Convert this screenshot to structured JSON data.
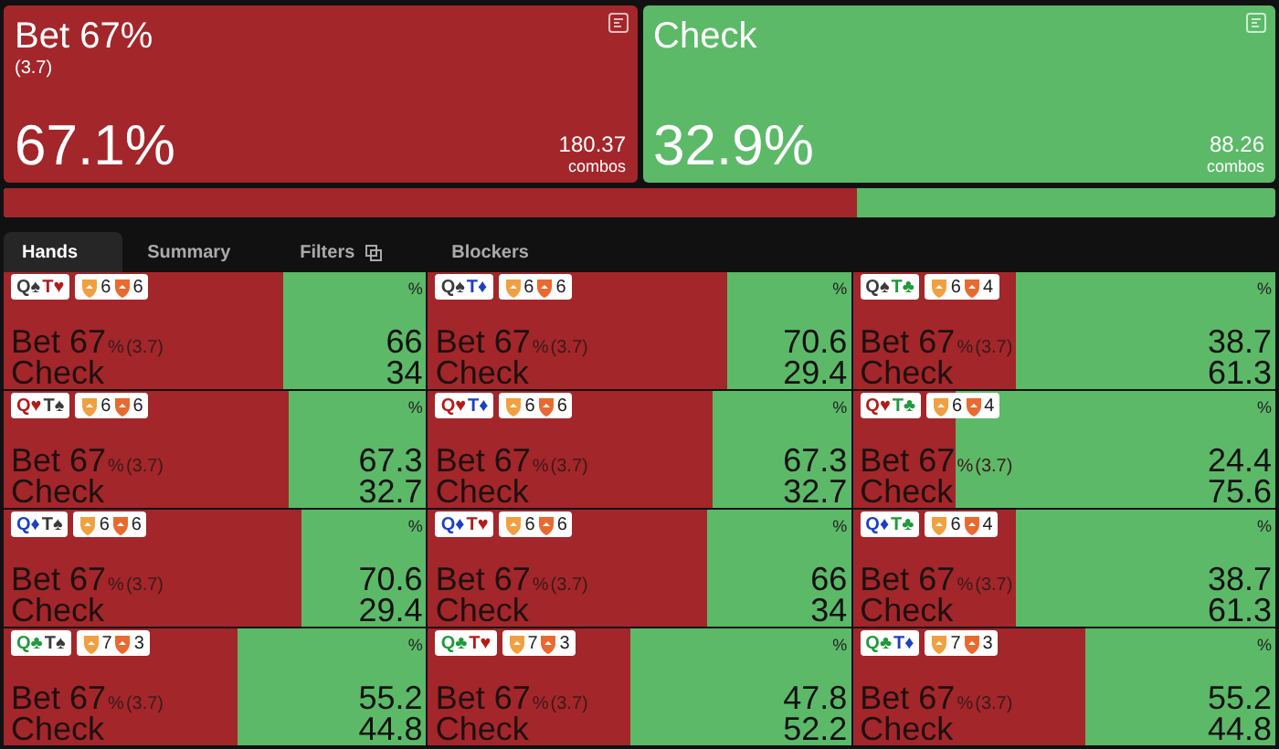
{
  "actions": [
    {
      "title": "Bet 67%",
      "size": "(3.7)",
      "percent": "67.1%",
      "combos": "180.37",
      "combos_label": "combos",
      "color": "#a3262a"
    },
    {
      "title": "Check",
      "percent": "32.9%",
      "combos": "88.26",
      "combos_label": "combos",
      "color": "#5cb968"
    }
  ],
  "summary_bar": {
    "level": 0.671
  },
  "tabs": [
    {
      "label": "Hands",
      "selected": true
    },
    {
      "label": "Summary",
      "selected": false
    },
    {
      "label": "Filters",
      "selected": false,
      "icon": true
    },
    {
      "label": "Blockers",
      "selected": false
    }
  ],
  "hand_grid": {
    "percent_header": "%",
    "rows": [
      [
        {
          "cards": [
            {
              "rank": "Q",
              "suit": "♠",
              "color": "#3a3a3a"
            },
            {
              "rank": "T",
              "suit": "♥",
              "color": "#b31b1b"
            }
          ],
          "blockers": [
            "6",
            "6"
          ],
          "bet_label": "Bet 67",
          "bet_unit": "%",
          "bet_size": "(3.7)",
          "check_label": "Check",
          "bet_value": "66",
          "check_value": "34",
          "level": 0.66
        },
        {
          "cards": [
            {
              "rank": "Q",
              "suit": "♠",
              "color": "#3a3a3a"
            },
            {
              "rank": "T",
              "suit": "♦",
              "color": "#1d3fc4"
            }
          ],
          "blockers": [
            "6",
            "6"
          ],
          "bet_label": "Bet 67",
          "bet_unit": "%",
          "bet_size": "(3.7)",
          "check_label": "Check",
          "bet_value": "70.6",
          "check_value": "29.4",
          "level": 0.706
        },
        {
          "cards": [
            {
              "rank": "Q",
              "suit": "♠",
              "color": "#3a3a3a"
            },
            {
              "rank": "T",
              "suit": "♣",
              "color": "#1e9a3a"
            }
          ],
          "blockers": [
            "6",
            "4"
          ],
          "bet_label": "Bet 67",
          "bet_unit": "%",
          "bet_size": "(3.7)",
          "check_label": "Check",
          "bet_value": "38.7",
          "check_value": "61.3",
          "level": 0.387
        }
      ],
      [
        {
          "cards": [
            {
              "rank": "Q",
              "suit": "♥",
              "color": "#b31b1b"
            },
            {
              "rank": "T",
              "suit": "♠",
              "color": "#3a3a3a"
            }
          ],
          "blockers": [
            "6",
            "6"
          ],
          "bet_label": "Bet 67",
          "bet_unit": "%",
          "bet_size": "(3.7)",
          "check_label": "Check",
          "bet_value": "67.3",
          "check_value": "32.7",
          "level": 0.673
        },
        {
          "cards": [
            {
              "rank": "Q",
              "suit": "♥",
              "color": "#b31b1b"
            },
            {
              "rank": "T",
              "suit": "♦",
              "color": "#1d3fc4"
            }
          ],
          "blockers": [
            "6",
            "6"
          ],
          "bet_label": "Bet 67",
          "bet_unit": "%",
          "bet_size": "(3.7)",
          "check_label": "Check",
          "bet_value": "67.3",
          "check_value": "32.7",
          "level": 0.673
        },
        {
          "cards": [
            {
              "rank": "Q",
              "suit": "♥",
              "color": "#b31b1b"
            },
            {
              "rank": "T",
              "suit": "♣",
              "color": "#1e9a3a"
            }
          ],
          "blockers": [
            "6",
            "4"
          ],
          "bet_label": "Bet 67",
          "bet_unit": "%",
          "bet_size": "(3.7)",
          "check_label": "Check",
          "bet_value": "24.4",
          "check_value": "75.6",
          "level": 0.244
        }
      ],
      [
        {
          "cards": [
            {
              "rank": "Q",
              "suit": "♦",
              "color": "#1d3fc4"
            },
            {
              "rank": "T",
              "suit": "♠",
              "color": "#3a3a3a"
            }
          ],
          "blockers": [
            "6",
            "6"
          ],
          "bet_label": "Bet 67",
          "bet_unit": "%",
          "bet_size": "(3.7)",
          "check_label": "Check",
          "bet_value": "70.6",
          "check_value": "29.4",
          "level": 0.706
        },
        {
          "cards": [
            {
              "rank": "Q",
              "suit": "♦",
              "color": "#1d3fc4"
            },
            {
              "rank": "T",
              "suit": "♥",
              "color": "#b31b1b"
            }
          ],
          "blockers": [
            "6",
            "6"
          ],
          "bet_label": "Bet 67",
          "bet_unit": "%",
          "bet_size": "(3.7)",
          "check_label": "Check",
          "bet_value": "66",
          "check_value": "34",
          "level": 0.66
        },
        {
          "cards": [
            {
              "rank": "Q",
              "suit": "♦",
              "color": "#1d3fc4"
            },
            {
              "rank": "T",
              "suit": "♣",
              "color": "#1e9a3a"
            }
          ],
          "blockers": [
            "6",
            "4"
          ],
          "bet_label": "Bet 67",
          "bet_unit": "%",
          "bet_size": "(3.7)",
          "check_label": "Check",
          "bet_value": "38.7",
          "check_value": "61.3",
          "level": 0.387
        }
      ],
      [
        {
          "cards": [
            {
              "rank": "Q",
              "suit": "♣",
              "color": "#1e9a3a"
            },
            {
              "rank": "T",
              "suit": "♠",
              "color": "#3a3a3a"
            }
          ],
          "blockers": [
            "7",
            "3"
          ],
          "bet_label": "Bet 67",
          "bet_unit": "%",
          "bet_size": "(3.7)",
          "check_label": "Check",
          "bet_value": "55.2",
          "check_value": "44.8",
          "level": 0.552
        },
        {
          "cards": [
            {
              "rank": "Q",
              "suit": "♣",
              "color": "#1e9a3a"
            },
            {
              "rank": "T",
              "suit": "♥",
              "color": "#b31b1b"
            }
          ],
          "blockers": [
            "7",
            "3"
          ],
          "bet_label": "Bet 67",
          "bet_unit": "%",
          "bet_size": "(3.7)",
          "check_label": "Check",
          "bet_value": "47.8",
          "check_value": "52.2",
          "level": 0.478
        },
        {
          "cards": [
            {
              "rank": "Q",
              "suit": "♣",
              "color": "#1e9a3a"
            },
            {
              "rank": "T",
              "suit": "♦",
              "color": "#1d3fc4"
            }
          ],
          "blockers": [
            "7",
            "3"
          ],
          "bet_label": "Bet 67",
          "bet_unit": "%",
          "bet_size": "(3.7)",
          "check_label": "Check",
          "bet_value": "55.2",
          "check_value": "44.8",
          "level": 0.552
        }
      ]
    ]
  }
}
